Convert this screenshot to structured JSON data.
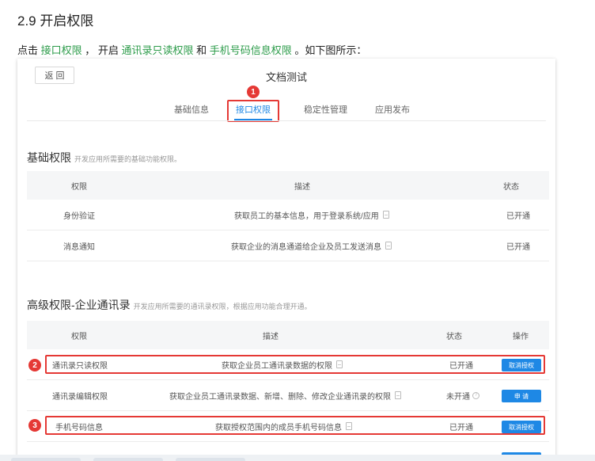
{
  "doc": {
    "heading": "2.9 开启权限",
    "intro_prefix": "点击 ",
    "intro_link1": "接口权限",
    "intro_mid1": " ， 开启 ",
    "intro_link2": "通讯录只读权限",
    "intro_mid2": " 和 ",
    "intro_link3": "手机号码信息权限",
    "intro_suffix": " 。如下图所示："
  },
  "app": {
    "back_label": "返 回",
    "title": "文档测试",
    "tabs": [
      {
        "label": "基础信息"
      },
      {
        "label": "接口权限",
        "active": true
      },
      {
        "label": "稳定性管理"
      },
      {
        "label": "应用发布"
      }
    ]
  },
  "badges": [
    "1",
    "2",
    "3"
  ],
  "basic": {
    "title": "基础权限",
    "subtitle": "开发应用所需要的基础功能权限。",
    "headers": [
      "权限",
      "描述",
      "状态"
    ],
    "rows": [
      {
        "name": "身份验证",
        "desc": "获取员工的基本信息，用于登录系统/应用",
        "status": "已开通"
      },
      {
        "name": "消息通知",
        "desc": "获取企业的消息通道给企业及员工发送消息",
        "status": "已开通"
      }
    ]
  },
  "advanced": {
    "title": "高级权限-企业通讯录",
    "subtitle": "开发应用所需要的通讯录权限，根据应用功能合理开通。",
    "headers": [
      "权限",
      "描述",
      "状态",
      "操作"
    ],
    "rows": [
      {
        "name": "通讯录只读权限",
        "desc": "获取企业员工通讯录数据的权限",
        "status": "已开通",
        "action": "取消授权"
      },
      {
        "name": "通讯录编辑权限",
        "desc": "获取企业员工通讯录数据、新增、删除、修改企业通讯录的权限",
        "status": "未开通",
        "action": "申 请"
      },
      {
        "name": "手机号码信息",
        "desc": "获取授权范围内的成员手机号码信息",
        "status": "已开通",
        "action": "取消授权"
      }
    ]
  },
  "colors": {
    "accent": "#1e88e5",
    "highlight": "#e53935",
    "link": "#2e9c4b"
  }
}
